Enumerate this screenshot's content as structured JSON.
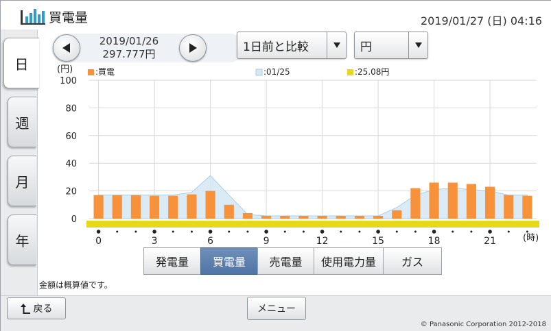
{
  "header": {
    "title": "買電量",
    "datetime": "2019/01/27 (日) 04:16"
  },
  "side_tabs": [
    {
      "label": "日",
      "active": true
    },
    {
      "label": "週",
      "active": false
    },
    {
      "label": "月",
      "active": false
    },
    {
      "label": "年",
      "active": false
    }
  ],
  "nav": {
    "date": "2019/01/26",
    "amount": "297.777円"
  },
  "compare_select": {
    "value": "1日前と比較"
  },
  "unit_select": {
    "value": "円"
  },
  "legend": {
    "current": ":買電",
    "previous": ":01/25",
    "previous_total": ":25.08円"
  },
  "colors": {
    "bar": "#f7913a",
    "area_fill": "#d5e8f4",
    "area_line": "#a9cfe6",
    "total_strip": "#e8d81a",
    "active_tab": "#5a7dab"
  },
  "kind_tabs": [
    {
      "label": "発電量",
      "active": false
    },
    {
      "label": "買電量",
      "active": true
    },
    {
      "label": "売電量",
      "active": false
    },
    {
      "label": "使用電力量",
      "active": false
    },
    {
      "label": "ガス",
      "active": false
    }
  ],
  "note": "金額は概算値です。",
  "footer": {
    "back_label": "戻る",
    "menu_label": "メニュー",
    "copyright": "© Panasonic Corporation 2012-2018"
  },
  "chart_data": {
    "type": "bar",
    "y_unit": "(円)",
    "x_unit": "(時)",
    "ylim": [
      0,
      100
    ],
    "y_ticks": [
      0,
      20,
      40,
      60,
      80,
      100
    ],
    "x_ticks": [
      0,
      3,
      6,
      9,
      12,
      15,
      18,
      21
    ],
    "categories": [
      0,
      1,
      2,
      3,
      4,
      5,
      6,
      7,
      8,
      9,
      10,
      11,
      12,
      13,
      14,
      15,
      16,
      17,
      18,
      19,
      20,
      21,
      22,
      23
    ],
    "series": [
      {
        "name": "買電",
        "type": "bar",
        "values": [
          17,
          17,
          17,
          16.5,
          16.5,
          17.5,
          20,
          10,
          4,
          2,
          2,
          2,
          2,
          2,
          2,
          2,
          6,
          22,
          26,
          26,
          25,
          23,
          17,
          16.5
        ]
      },
      {
        "name": "01/25",
        "type": "area",
        "values": [
          17,
          17,
          17,
          17,
          17,
          19,
          31,
          17,
          3,
          2,
          2,
          2,
          2,
          2,
          2,
          2,
          8,
          17,
          21,
          22,
          21,
          20,
          17,
          17
        ]
      }
    ],
    "grid": true
  }
}
